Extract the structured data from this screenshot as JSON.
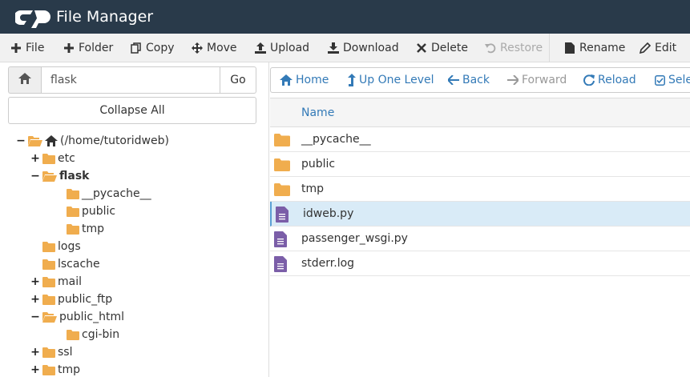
{
  "app": {
    "title": "File Manager"
  },
  "colors": {
    "header_bg": "#293a4a",
    "folder": "#f0ad4e",
    "link": "#337ab7",
    "file_icon": "#7b5ea8",
    "selected_row": "#d9ebf7"
  },
  "toolbar": {
    "items": [
      {
        "label": "File",
        "icon": "plus-icon"
      },
      {
        "label": "Folder",
        "icon": "plus-icon"
      },
      {
        "label": "Copy",
        "icon": "copy-icon"
      },
      {
        "label": "Move",
        "icon": "move-icon"
      },
      {
        "label": "Upload",
        "icon": "upload-icon"
      },
      {
        "label": "Download",
        "icon": "download-icon"
      },
      {
        "label": "Delete",
        "icon": "close-icon"
      },
      {
        "label": "Restore",
        "icon": "undo-icon",
        "disabled": true
      },
      {
        "label": "Rename",
        "icon": "file-icon"
      },
      {
        "label": "Edit",
        "icon": "pencil-icon"
      }
    ]
  },
  "sidebar": {
    "path_value": "flask",
    "go_label": "Go",
    "collapse_label": "Collapse All",
    "tree": [
      {
        "label": "(/home/tutoridweb)",
        "toggle": "−",
        "home": true
      },
      {
        "label": "etc",
        "toggle": "+"
      },
      {
        "label": "flask",
        "toggle": "−",
        "bold": true
      },
      {
        "label": "__pycache__",
        "toggle": ""
      },
      {
        "label": "public",
        "toggle": ""
      },
      {
        "label": "tmp",
        "toggle": ""
      },
      {
        "label": "logs",
        "toggle": ""
      },
      {
        "label": "lscache",
        "toggle": ""
      },
      {
        "label": "mail",
        "toggle": "+"
      },
      {
        "label": "public_ftp",
        "toggle": "+"
      },
      {
        "label": "public_html",
        "toggle": "−"
      },
      {
        "label": "cgi-bin",
        "toggle": ""
      },
      {
        "label": "ssl",
        "toggle": "+"
      },
      {
        "label": "tmp",
        "toggle": "+"
      }
    ]
  },
  "nav": {
    "items": [
      {
        "label": "Home",
        "icon": "home-icon"
      },
      {
        "label": "Up One Level",
        "icon": "level-up-icon"
      },
      {
        "label": "Back",
        "icon": "arrow-left-icon"
      },
      {
        "label": "Forward",
        "icon": "arrow-right-icon",
        "disabled": true
      },
      {
        "label": "Reload",
        "icon": "refresh-icon"
      },
      {
        "label": "Selec",
        "icon": "checkbox-icon"
      }
    ]
  },
  "table": {
    "column_name": "Name",
    "rows": [
      {
        "name": "__pycache__",
        "type": "folder"
      },
      {
        "name": "public",
        "type": "folder"
      },
      {
        "name": "tmp",
        "type": "folder"
      },
      {
        "name": "idweb.py",
        "type": "file",
        "selected": true
      },
      {
        "name": "passenger_wsgi.py",
        "type": "file"
      },
      {
        "name": "stderr.log",
        "type": "file"
      }
    ]
  }
}
